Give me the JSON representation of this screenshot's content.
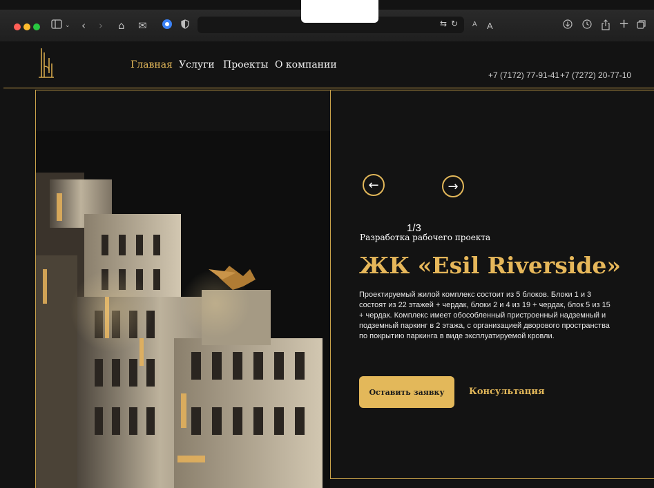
{
  "browser": {
    "icons": [
      "sidebar-icon",
      "chevron-down-icon",
      "back-icon",
      "forward-icon",
      "home-icon",
      "mail-icon",
      "extension-icon",
      "shield-icon",
      "translate-icon",
      "reload-icon",
      "download-icon",
      "history-icon",
      "share-icon",
      "new-tab-icon",
      "tabs-icon"
    ],
    "font_small": "A",
    "font_large": "A"
  },
  "nav": {
    "items": [
      {
        "label": "Главная",
        "active": true
      },
      {
        "label": "Услуги"
      },
      {
        "label": "Проекты"
      },
      {
        "label": "О компании"
      }
    ]
  },
  "contacts": {
    "phone1": "+7 (7172) 77-91-41",
    "phone2": "+7 (7272) 20-77-10"
  },
  "slider": {
    "counter": "1/3",
    "prev_icon": "arrow-left-icon",
    "next_icon": "arrow-right-icon"
  },
  "project": {
    "subtitle": "Разработка рабочего проекта",
    "title": "ЖК «Esil Riverside»",
    "description": "Проектируемый жилой комплекс состоит из 5 блоков. Блоки 1 и 3 состоят из 22 этажей + чердак, блоки 2 и 4 из 19 + чердак, блок 5 из 15 + чердак. Комплекс имеет обособленный пристроенный надземный и подземный паркинг в 2 этажа, с организацией дворового пространства по покрытию паркинга в виде эксплуатируемой кровли."
  },
  "actions": {
    "request": "Оставить заявку",
    "consult": "Консультация"
  },
  "colors": {
    "accent": "#e3b85a",
    "background": "#131313"
  }
}
